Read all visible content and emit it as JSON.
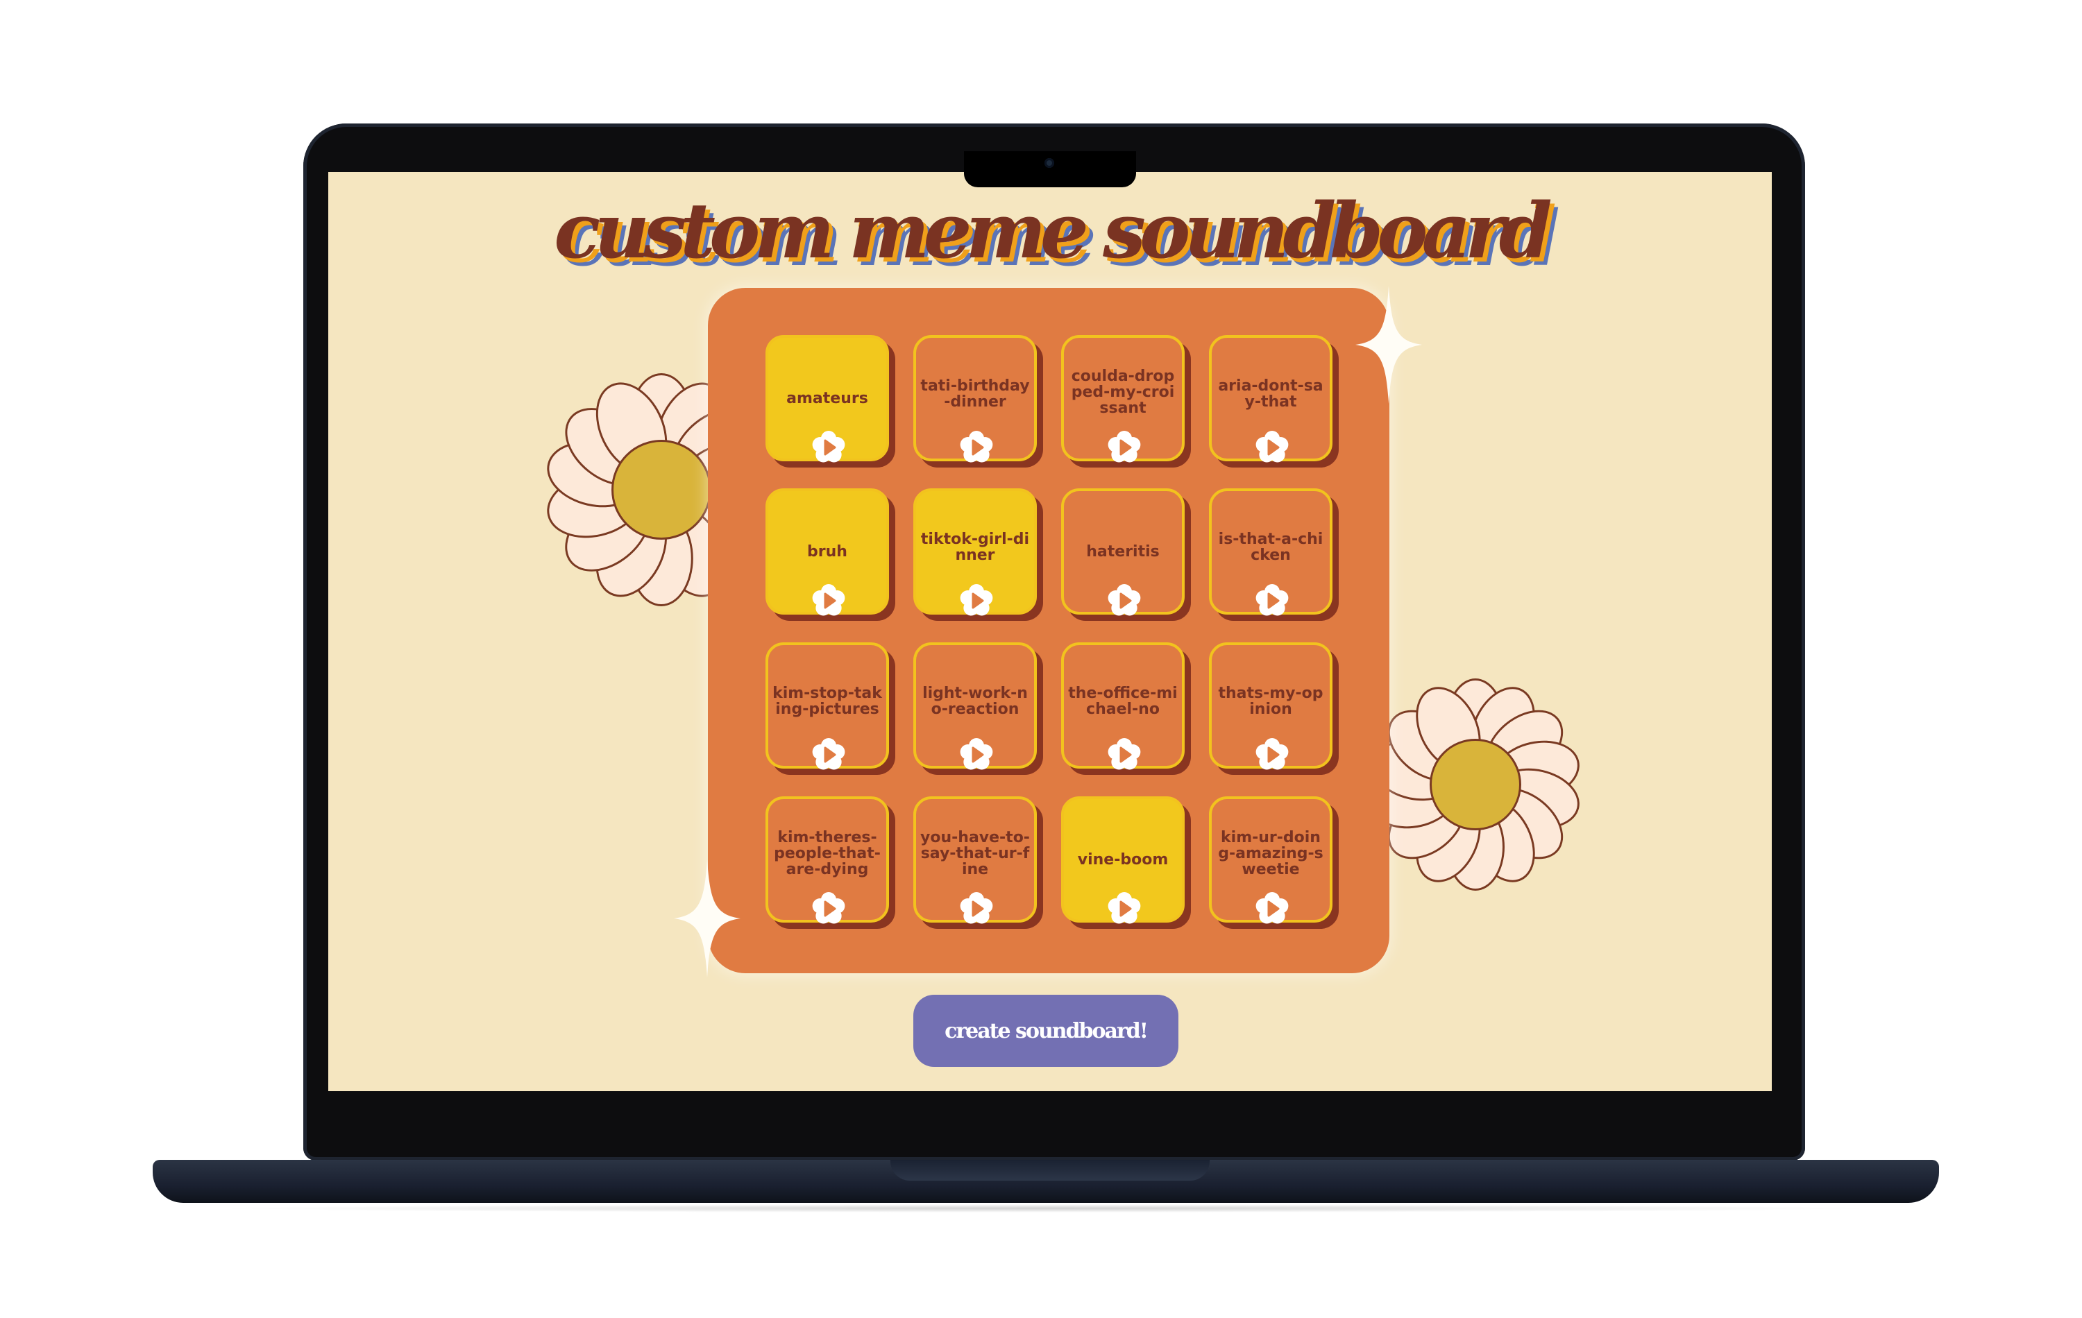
{
  "app": {
    "title": "custom meme soundboard",
    "create_button_label": "create soundboard!"
  },
  "colors": {
    "background": "#f5e6c0",
    "board": "#e07b42",
    "tile_selected": "#f2c81d",
    "tile_border": "#f2c31e",
    "title_text": "#7a3322",
    "button": "#7370b3"
  },
  "icons": {
    "play": "flower-play-icon",
    "decoration": "daisy-flower",
    "sparkle": "four-point-sparkle"
  },
  "tiles": [
    {
      "label": "amateurs",
      "selected": true
    },
    {
      "label": "tati-birthday-dinner",
      "selected": false
    },
    {
      "label": "coulda-dropped-my-croissant",
      "selected": false
    },
    {
      "label": "aria-dont-say-that",
      "selected": false
    },
    {
      "label": "bruh",
      "selected": true
    },
    {
      "label": "tiktok-girl-dinner",
      "selected": true
    },
    {
      "label": "hateritis",
      "selected": false
    },
    {
      "label": "is-that-a-chicken",
      "selected": false
    },
    {
      "label": "kim-stop-taking-pictures",
      "selected": false
    },
    {
      "label": "light-work-no-reaction",
      "selected": false
    },
    {
      "label": "the-office-michael-no",
      "selected": false
    },
    {
      "label": "thats-my-opinion",
      "selected": false
    },
    {
      "label": "kim-theres-people-that-are-dying",
      "selected": false
    },
    {
      "label": "you-have-to-say-that-ur-fine",
      "selected": false
    },
    {
      "label": "vine-boom",
      "selected": true
    },
    {
      "label": "kim-ur-doing-amazing-sweetie",
      "selected": false
    }
  ]
}
